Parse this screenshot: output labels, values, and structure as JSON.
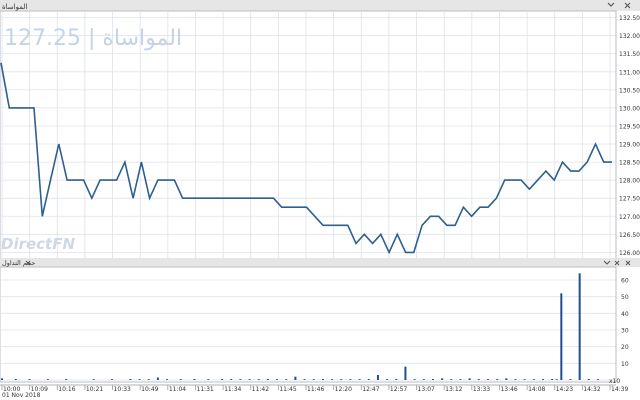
{
  "price_panel": {
    "title": "المواساة",
    "watermark": "المواساة | 127.25",
    "brand": "DirectFN",
    "icons": [
      "chevron-down-icon",
      "close-icon"
    ]
  },
  "volume_panel": {
    "title": "حجم التداول",
    "icons": [
      "close-icon",
      "chevron-down-icon",
      "close-icon"
    ],
    "scale_label": "x10"
  },
  "date_label": "01 Nov 2018",
  "colors": {
    "line": "#2f5f8f",
    "bar": "#1f4f8f",
    "grid": "#dde2ea",
    "watermark": "#c6d2e6"
  },
  "chart_data": [
    {
      "type": "line",
      "ylim": [
        125.9,
        132.6
      ],
      "yticks": [
        "126.00",
        "126.50",
        "127.00",
        "127.50",
        "128.00",
        "128.50",
        "129.00",
        "129.50",
        "130.00",
        "130.50",
        "131.00",
        "131.50",
        "132.00",
        "132.50"
      ],
      "x": [
        0,
        1,
        2,
        3,
        4,
        5,
        6,
        7,
        8,
        9,
        10,
        11,
        12,
        13,
        14,
        15,
        16,
        17,
        18,
        19,
        20,
        21,
        22,
        23,
        24,
        25,
        26,
        27,
        28,
        29,
        30,
        31,
        32,
        33,
        34,
        35,
        36,
        37,
        38,
        39,
        40,
        41,
        42,
        43,
        44,
        45,
        46,
        47,
        48,
        49,
        50,
        51,
        52,
        53,
        54,
        55,
        56,
        57,
        58,
        59,
        60,
        61,
        62,
        63,
        64,
        65,
        66,
        67,
        68,
        69,
        70,
        71,
        72,
        73,
        74
      ],
      "values": [
        131.25,
        130.0,
        130.0,
        130.0,
        130.0,
        127.0,
        128.0,
        129.0,
        128.0,
        128.0,
        128.0,
        127.5,
        128.0,
        128.0,
        128.0,
        128.5,
        127.5,
        128.5,
        127.5,
        128.0,
        128.0,
        128.0,
        127.5,
        127.5,
        127.5,
        127.5,
        127.5,
        127.5,
        127.5,
        127.5,
        127.5,
        127.5,
        127.5,
        127.5,
        127.25,
        127.25,
        127.25,
        127.25,
        127.0,
        126.75,
        126.75,
        126.75,
        126.75,
        126.25,
        126.5,
        126.25,
        126.5,
        126.0,
        126.5,
        126.0,
        126.0,
        126.75,
        127.0,
        127.0,
        126.75,
        126.75,
        127.25,
        127.0,
        127.25,
        127.25,
        127.5,
        128.0,
        128.0,
        128.0,
        127.75,
        128.0,
        128.25,
        128.0,
        128.5,
        128.25,
        128.25,
        128.5,
        129.0,
        128.5,
        128.5
      ]
    },
    {
      "type": "bar",
      "ylim": [
        0,
        66
      ],
      "yticks": [
        "0",
        "10",
        "20",
        "30",
        "40",
        "50",
        "60"
      ],
      "xticks": [
        "10:00",
        "10:09",
        "10:16",
        "10:21",
        "10:33",
        "10:49",
        "11:04",
        "11:31",
        "11:34",
        "11:42",
        "11:45",
        "11:46",
        "12:20",
        "12:47",
        "12:57",
        "13:07",
        "13:12",
        "13:33",
        "13:46",
        "14:08",
        "14:23",
        "14:32",
        "14:39"
      ],
      "x": [
        0,
        3,
        6,
        10,
        14,
        20,
        24,
        28,
        30,
        32,
        34,
        36,
        39,
        42,
        45,
        48,
        50,
        52,
        54,
        56,
        58,
        60,
        62,
        64,
        66,
        68,
        70,
        72,
        74,
        76,
        78,
        80,
        82,
        84,
        86,
        88,
        90,
        92,
        94,
        96,
        98,
        100,
        102,
        104,
        106,
        108,
        110,
        112,
        114,
        116,
        118,
        120,
        121,
        122,
        124,
        126,
        128,
        130
      ],
      "values": [
        1,
        0.6,
        0.5,
        0.5,
        0.6,
        0.5,
        0.5,
        0.6,
        0.5,
        0.5,
        1.5,
        0.5,
        0.5,
        0.6,
        0.5,
        0.6,
        0.5,
        0.5,
        0.5,
        0.5,
        0.6,
        0.5,
        0.5,
        2,
        0.5,
        0.5,
        0.6,
        0.5,
        0.5,
        0.5,
        0.5,
        0.5,
        3,
        0.5,
        0.6,
        8,
        0.5,
        0.5,
        0.6,
        1,
        0.5,
        0.5,
        1,
        0.5,
        0.5,
        0.5,
        1,
        0.5,
        0.5,
        0.5,
        0.5,
        0.6,
        0.5,
        52,
        0.5,
        64,
        0.6,
        0.5
      ]
    }
  ]
}
